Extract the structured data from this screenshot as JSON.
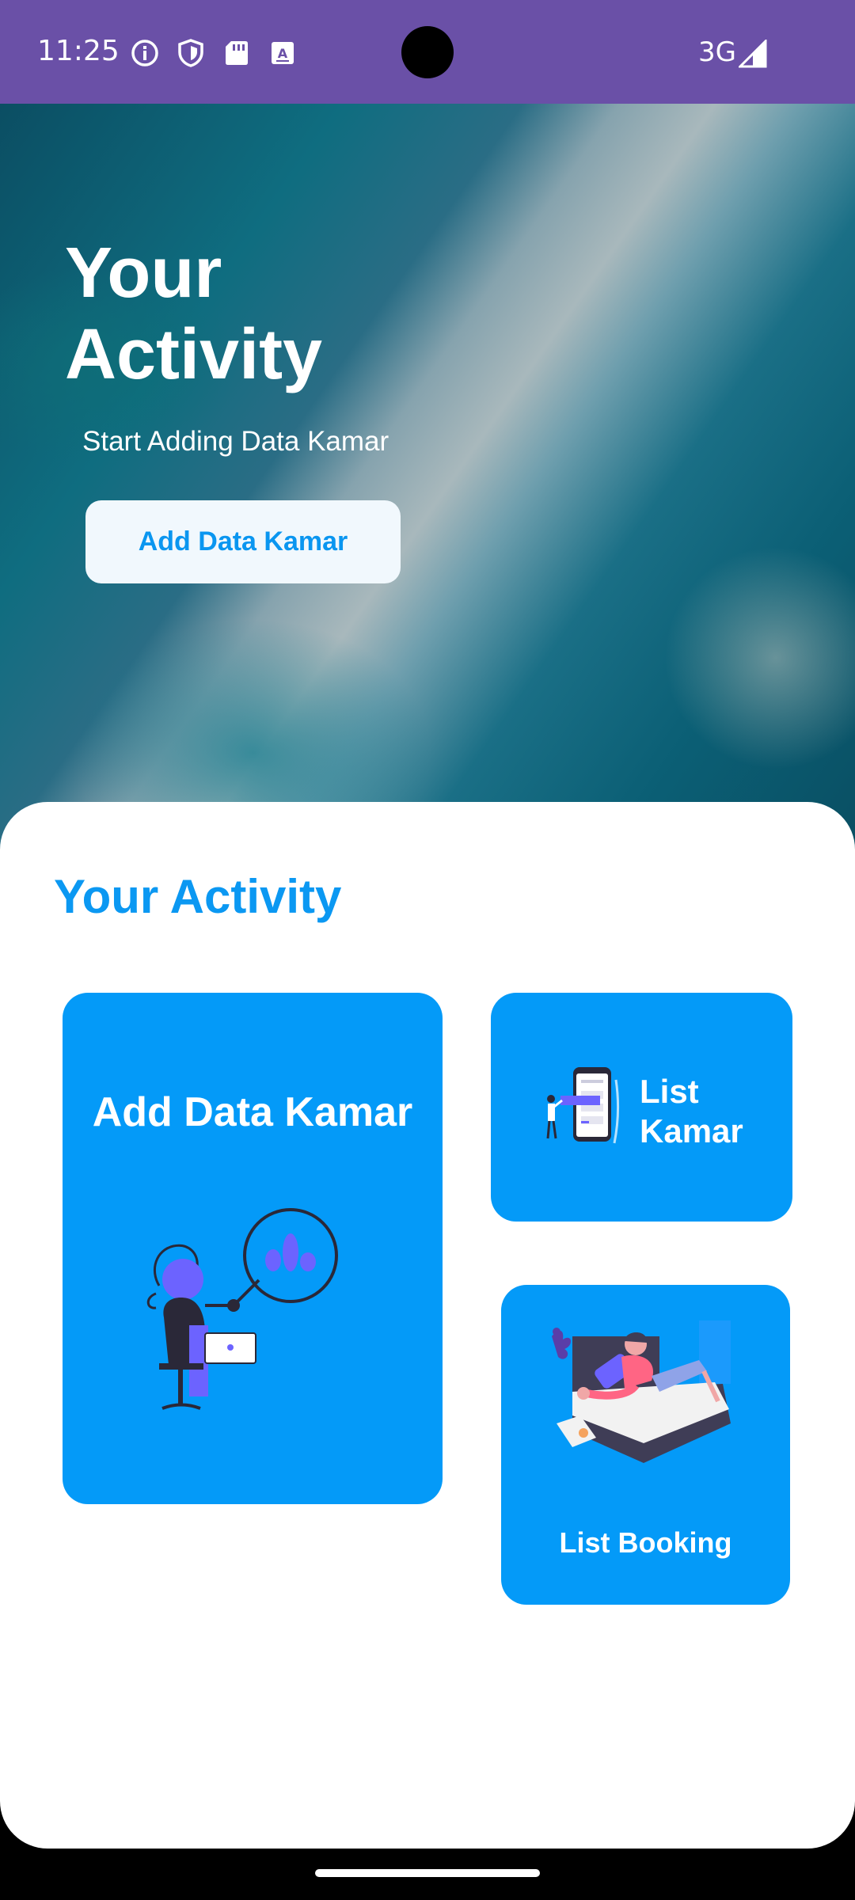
{
  "status_bar": {
    "time": "11:25",
    "network": "3G"
  },
  "hero": {
    "title": "Your Activity",
    "subtitle": "Start Adding Data Kamar",
    "button_label": "Add Data Kamar"
  },
  "activity": {
    "title": "Your Activity",
    "cards": {
      "add": "Add Data Kamar",
      "list_kamar": "List Kamar",
      "list_booking": "List Booking"
    }
  },
  "colors": {
    "status_bar": "#6a50a7",
    "accent": "#049af8",
    "title_blue": "#0b98f2"
  }
}
